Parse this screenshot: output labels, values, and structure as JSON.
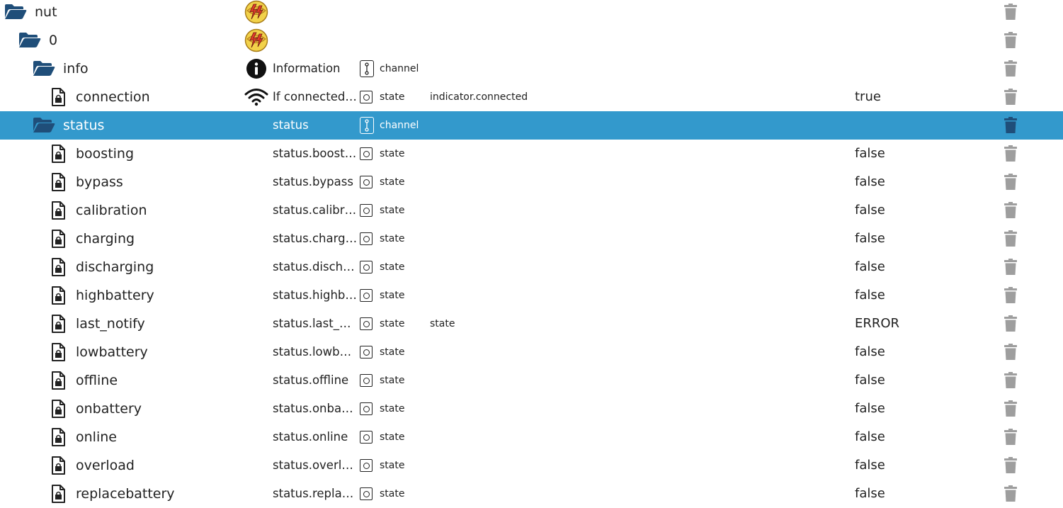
{
  "tree": {
    "rows": [
      {
        "name": "nut",
        "depth": 0,
        "kind": "folder",
        "icon": "adapter-logo-icon",
        "description": "",
        "type": "",
        "role": "",
        "value": "",
        "selected": false
      },
      {
        "name": "0",
        "depth": 1,
        "kind": "folder",
        "icon": "adapter-logo-icon",
        "description": "",
        "type": "",
        "role": "",
        "value": "",
        "selected": false
      },
      {
        "name": "info",
        "depth": 2,
        "kind": "folder",
        "icon": "info-icon",
        "description": "Information",
        "type": "channel",
        "role": "",
        "value": "",
        "selected": false
      },
      {
        "name": "connection",
        "depth": 3,
        "kind": "state",
        "icon": "wifi-icon",
        "description": "If connected to UPS",
        "type": "state",
        "role": "indicator.connected",
        "value": "true",
        "selected": false
      },
      {
        "name": "status",
        "depth": 2,
        "kind": "folder",
        "icon": "",
        "description": "status",
        "type": "channel",
        "role": "",
        "value": "",
        "selected": true
      },
      {
        "name": "boosting",
        "depth": 3,
        "kind": "state",
        "icon": "",
        "description": "status.boosting",
        "type": "state",
        "role": "",
        "value": "false",
        "selected": false
      },
      {
        "name": "bypass",
        "depth": 3,
        "kind": "state",
        "icon": "",
        "description": "status.bypass",
        "type": "state",
        "role": "",
        "value": "false",
        "selected": false
      },
      {
        "name": "calibration",
        "depth": 3,
        "kind": "state",
        "icon": "",
        "description": "status.calibration",
        "type": "state",
        "role": "",
        "value": "false",
        "selected": false
      },
      {
        "name": "charging",
        "depth": 3,
        "kind": "state",
        "icon": "",
        "description": "status.charging",
        "type": "state",
        "role": "",
        "value": "false",
        "selected": false
      },
      {
        "name": "discharging",
        "depth": 3,
        "kind": "state",
        "icon": "",
        "description": "status.discharging",
        "type": "state",
        "role": "",
        "value": "false",
        "selected": false
      },
      {
        "name": "highbattery",
        "depth": 3,
        "kind": "state",
        "icon": "",
        "description": "status.highbattery",
        "type": "state",
        "role": "",
        "value": "false",
        "selected": false
      },
      {
        "name": "last_notify",
        "depth": 3,
        "kind": "state",
        "icon": "",
        "description": "status.last_notify",
        "type": "state",
        "role": "state",
        "value": "ERROR",
        "selected": false
      },
      {
        "name": "lowbattery",
        "depth": 3,
        "kind": "state",
        "icon": "",
        "description": "status.lowbattery",
        "type": "state",
        "role": "",
        "value": "false",
        "selected": false
      },
      {
        "name": "offline",
        "depth": 3,
        "kind": "state",
        "icon": "",
        "description": "status.offline",
        "type": "state",
        "role": "",
        "value": "false",
        "selected": false
      },
      {
        "name": "onbattery",
        "depth": 3,
        "kind": "state",
        "icon": "",
        "description": "status.onbattery",
        "type": "state",
        "role": "",
        "value": "false",
        "selected": false
      },
      {
        "name": "online",
        "depth": 3,
        "kind": "state",
        "icon": "",
        "description": "status.online",
        "type": "state",
        "role": "",
        "value": "false",
        "selected": false
      },
      {
        "name": "overload",
        "depth": 3,
        "kind": "state",
        "icon": "",
        "description": "status.overload",
        "type": "state",
        "role": "",
        "value": "false",
        "selected": false
      },
      {
        "name": "replacebattery",
        "depth": 3,
        "kind": "state",
        "icon": "",
        "description": "status.replacebattery",
        "type": "state",
        "role": "",
        "value": "false",
        "selected": false
      }
    ]
  },
  "colors": {
    "folder": "#1f4e79",
    "selected_bg": "#3399cc",
    "trash": "#9e9e9e",
    "text": "#222222"
  }
}
